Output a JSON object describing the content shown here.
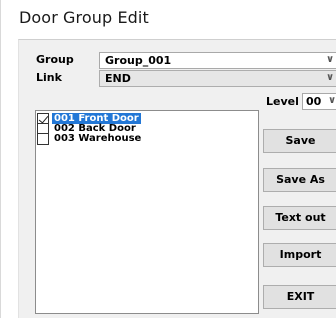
{
  "window": {
    "title": "Door Group Edit"
  },
  "form": {
    "group_label": "Group",
    "group_value": "Group_001",
    "link_label": "Link",
    "link_value": "END",
    "level_label": "Level",
    "level_value": "00"
  },
  "doors": [
    {
      "label": "001 Front Door",
      "checked": true,
      "selected": true
    },
    {
      "label": "002 Back Door",
      "checked": false,
      "selected": false
    },
    {
      "label": "003 Warehouse",
      "checked": false,
      "selected": false
    }
  ],
  "buttons": {
    "save": "Save",
    "save_as": "Save As",
    "text_out": "Text out",
    "import": "Import",
    "exit": "EXIT"
  },
  "icons": {
    "dropdown": "chevron-down-icon",
    "checkbox": "checkbox-icon"
  },
  "colors": {
    "selection": "#2277d6",
    "panel": "#f0f0f0"
  }
}
